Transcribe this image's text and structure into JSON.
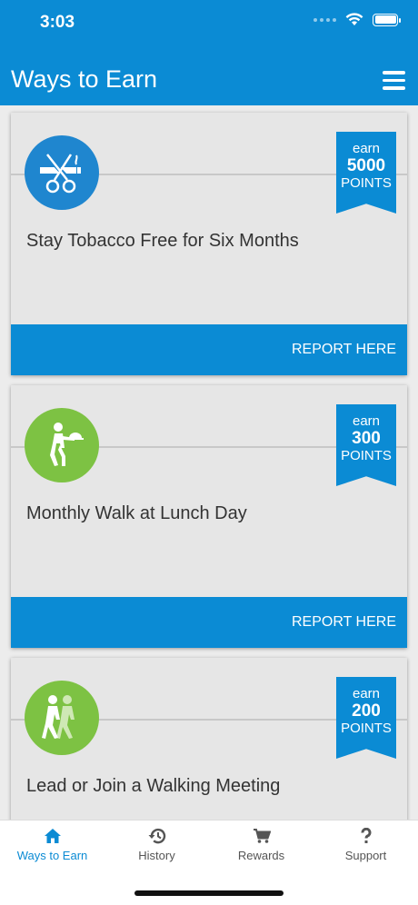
{
  "status_bar": {
    "time": "3:03"
  },
  "header": {
    "title": "Ways to Earn"
  },
  "cards": [
    {
      "title": "Stay Tobacco Free for Six Months",
      "earn_label": "earn",
      "points": "5000",
      "points_label": "POINTS",
      "action": "REPORT HERE",
      "icon": "no-smoking-scissors-icon",
      "icon_color": "#1f86cf"
    },
    {
      "title": "Monthly Walk at Lunch Day",
      "earn_label": "earn",
      "points": "300",
      "points_label": "POINTS",
      "action": "REPORT HERE",
      "icon": "walking-waiter-icon",
      "icon_color": "#7dc243"
    },
    {
      "title": "Lead or Join a Walking Meeting",
      "earn_label": "earn",
      "points": "200",
      "points_label": "POINTS",
      "icon": "two-walkers-icon",
      "icon_color": "#7dc243"
    }
  ],
  "tabs": [
    {
      "label": "Ways to Earn",
      "icon": "home-icon",
      "active": true
    },
    {
      "label": "History",
      "icon": "history-icon"
    },
    {
      "label": "Rewards",
      "icon": "cart-icon"
    },
    {
      "label": "Support",
      "icon": "question-icon"
    }
  ],
  "colors": {
    "brand": "#0b8bd4",
    "green": "#7dc243",
    "card_bg": "#e6e6e6"
  }
}
